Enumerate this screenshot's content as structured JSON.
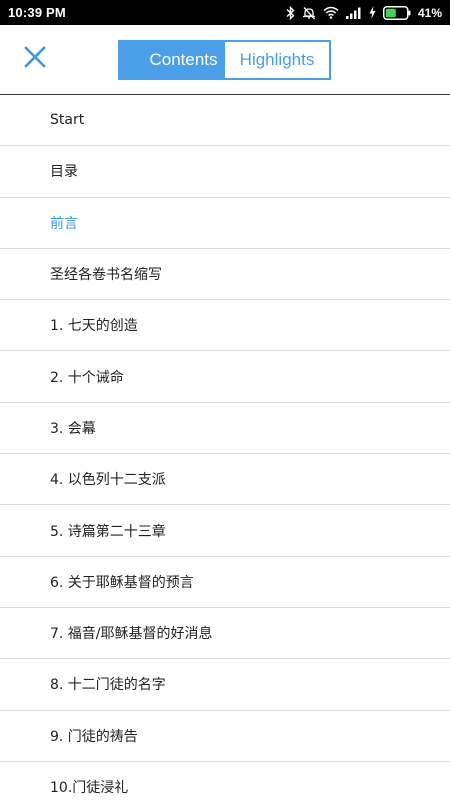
{
  "status_bar": {
    "time": "10:39 PM",
    "battery_percent": "41%",
    "icons": [
      "bluetooth-icon",
      "mute-icon",
      "wifi-icon",
      "signal-icon",
      "charging-icon",
      "battery-icon"
    ]
  },
  "header": {
    "close_icon": "close-icon",
    "tabs": [
      {
        "label": "Contents",
        "active": true
      },
      {
        "label": "Highlights",
        "active": false
      }
    ]
  },
  "toc": {
    "items": [
      {
        "label": "Start"
      },
      {
        "label": "目录"
      },
      {
        "label": "前言",
        "current": true
      },
      {
        "label": "圣经各卷书名缩写"
      },
      {
        "label": "1. 七天的创造"
      },
      {
        "label": "2. 十个诫命"
      },
      {
        "label": "3. 会幕"
      },
      {
        "label": "4. 以色列十二支派"
      },
      {
        "label": "5. 诗篇第二十三章"
      },
      {
        "label": "6. 关于耶稣基督的预言"
      },
      {
        "label": "7. 福音/耶稣基督的好消息"
      },
      {
        "label": "8. 十二门徒的名字"
      },
      {
        "label": "9. 门徒的祷告"
      },
      {
        "label": "10.门徒浸礼"
      }
    ]
  },
  "colors": {
    "accent": "#4a9fe8",
    "current_item": "#3f96dd",
    "text": "#222222",
    "divider": "#dcdcdc"
  }
}
